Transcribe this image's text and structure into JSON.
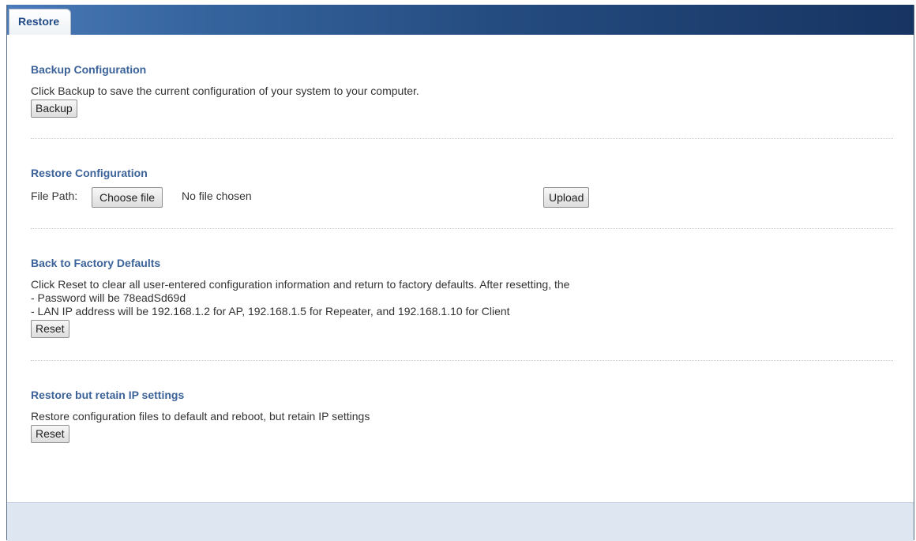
{
  "tab": {
    "label": "Restore"
  },
  "backup": {
    "heading": "Backup Configuration",
    "description": "Click Backup to save the current configuration of your system to your computer.",
    "button": "Backup"
  },
  "restore": {
    "heading": "Restore Configuration",
    "file_path_label": "File Path:",
    "choose_file_button": "Choose file",
    "no_file_text": "No file chosen",
    "upload_button": "Upload"
  },
  "factory": {
    "heading": "Back to Factory Defaults",
    "line1": "Click Reset to clear all user-entered configuration information and return to factory defaults. After resetting, the",
    "line2": "- Password will be 78eadSd69d",
    "line3": "- LAN IP address will be 192.168.1.2 for AP, 192.168.1.5 for Repeater, and 192.168.1.10 for Client",
    "button": "Reset"
  },
  "retain": {
    "heading": "Restore but retain IP settings",
    "description": "Restore configuration files to default and reboot, but retain IP settings",
    "button": "Reset"
  }
}
